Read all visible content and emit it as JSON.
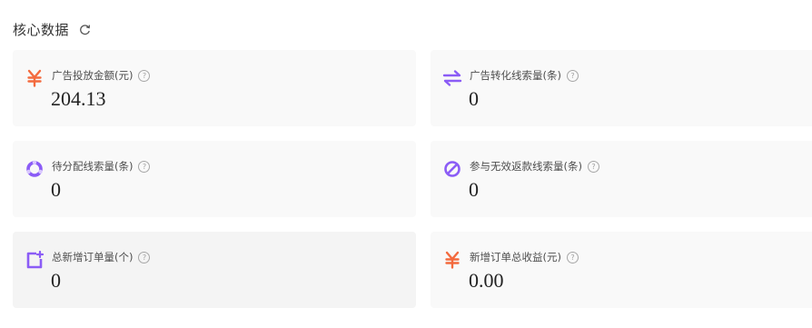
{
  "section": {
    "title": "核心数据",
    "refresh_icon": "refresh-icon"
  },
  "colors": {
    "orange": "#f36a3e",
    "purple": "#8b5cf6",
    "card_bg": "#f9f9f9",
    "help_icon": "#a7a7a7"
  },
  "cards": [
    {
      "label": "广告投放金额(元)",
      "value": "204.13",
      "icon": "yuan-icon",
      "icon_color": "#f36a3e"
    },
    {
      "label": "广告转化线索量(条)",
      "value": "0",
      "icon": "exchange-arrows-icon",
      "icon_color": "#8b5cf6"
    },
    {
      "label": "待分配线索量(条)",
      "value": "0",
      "icon": "ring-icon",
      "icon_color": "#8b5cf6"
    },
    {
      "label": "参与无效返款线索量(条)",
      "value": "0",
      "icon": "forbidden-icon",
      "icon_color": "#8b5cf6"
    },
    {
      "label": "总新增订单量(个)",
      "value": "0",
      "icon": "new-document-icon",
      "icon_color": "#8b5cf6"
    },
    {
      "label": "新增订单总收益(元)",
      "value": "0.00",
      "icon": "yuan-icon",
      "icon_color": "#f36a3e"
    }
  ],
  "help_glyph": "?"
}
